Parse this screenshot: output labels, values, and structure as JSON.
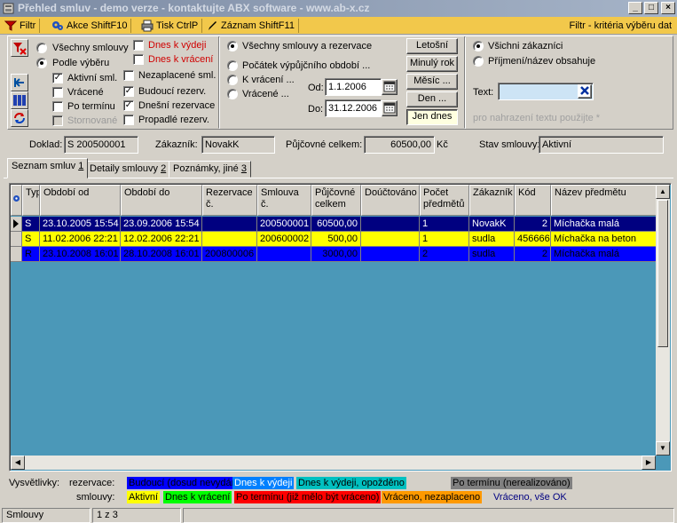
{
  "window": {
    "title": "Přehled smluv - demo verze - kontaktujte ABX software - www.ab-x.cz"
  },
  "toolbar": {
    "items": [
      {
        "label": "Filtr",
        "icon": "filter-icon"
      },
      {
        "label": "Akce ShiftF10",
        "icon": "gears-icon"
      },
      {
        "label": "Tisk CtrlP",
        "icon": "printer-icon"
      },
      {
        "label": "Záznam ShiftF11",
        "icon": "pencil-icon"
      }
    ],
    "right_text": "Filtr - kritéria výběru dat"
  },
  "filter": {
    "contracts": {
      "all": "Všechny smlouvy",
      "selected": "Podle výběru",
      "active": "Aktivní sml.",
      "returned": "Vrácené",
      "overdue": "Po termínu",
      "cancelled": "Stornované"
    },
    "due": {
      "due_issue": "Dnes k výdeji",
      "due_return": "Dnes k vrácení",
      "unpaid": "Nezaplacené sml.",
      "future_res": "Budoucí rezerv.",
      "today_res": "Dnešní rezervace",
      "expired_res": "Propadlé rezerv."
    },
    "period": {
      "all": "Všechny smlouvy a rezervace",
      "start": "Počátek výpůjčního období ...",
      "to_return": "K vrácení ...",
      "returned": "Vrácené ...",
      "from_label": "Od:",
      "from_value": "1.1.2006",
      "to_label": "Do:",
      "to_value": "31.12.2006"
    },
    "buttons": {
      "this_year": "Letošní",
      "last_year": "Minulý rok",
      "month": "Měsíc ...",
      "day": "Den ...",
      "today": "Jen dnes"
    },
    "customers": {
      "all": "Všichni zákazníci",
      "by_name": "Příjmení/název obsahuje",
      "text_label": "Text:",
      "text_value": "",
      "hint": "pro nahrazení textu použijte *"
    }
  },
  "info": {
    "doc_label": "Doklad:",
    "doc_value": "S 200500001",
    "cust_label": "Zákazník:",
    "cust_value": "NovakK",
    "total_label": "Půjčovné celkem:",
    "total_value": "60500,00",
    "currency": "Kč",
    "state_label": "Stav smlouvy:",
    "state_value": "Aktivní"
  },
  "tabs": [
    {
      "label": "Seznam smluv",
      "key": "1"
    },
    {
      "label": "Detaily smlouvy",
      "key": "2"
    },
    {
      "label": "Poznámky, jiné",
      "key": "3"
    }
  ],
  "grid": {
    "columns": [
      "Typ",
      "Období od",
      "Období do",
      "Rezervace č.",
      "Smlouva č.",
      "Půjčovné celkem",
      "Doúčtováno",
      "Počet předmětů",
      "Zákazník",
      "Kód",
      "Název předmětu"
    ],
    "rows": [
      [
        "S",
        "23.10.2005 15:54",
        "23.09.2006 15:54",
        "",
        "200500001",
        "60500,00",
        "",
        "1",
        "NovakK",
        "2",
        "Míchačka malá"
      ],
      [
        "S",
        "11.02.2006 22:21",
        "12.02.2006 22:21",
        "",
        "200600002",
        "500,00",
        "",
        "1",
        "sudla",
        "456666",
        "Míchačka na beton"
      ],
      [
        "R",
        "23.10.2008 16:01",
        "28.10.2008 16:01",
        "200800006",
        "",
        "3000,00",
        "",
        "2",
        "sudla",
        "2",
        "Míchačka malá"
      ]
    ],
    "row_colors": [
      "#000080",
      "#ffff00",
      "#0000ff"
    ],
    "row_text_colors": [
      "#ffffff",
      "#000000",
      "#000000"
    ]
  },
  "legend": {
    "title": "Vysvětlivky:",
    "res_label": "rezervace:",
    "contracts_label": "smlouvy:",
    "res_items": [
      {
        "text": "Budoucí (dosud nevydáno)",
        "bg": "#0000ff",
        "fg": "#000000"
      },
      {
        "text": "Dnes k výdeji",
        "bg": "#0080ff",
        "fg": "#ffffff"
      },
      {
        "text": "Dnes k výdeji, opožděno",
        "bg": "#00c0c0",
        "fg": "#000000"
      },
      {
        "text": "Po termínu (nerealizováno)",
        "bg": "#808080",
        "fg": "#000000"
      }
    ],
    "contract_items": [
      {
        "text": "Aktivní",
        "bg": "#ffff00",
        "fg": "#000000"
      },
      {
        "text": "Dnes k vrácení",
        "bg": "#00ff00",
        "fg": "#000000"
      },
      {
        "text": "Po termínu (již mělo být vráceno)",
        "bg": "#ff0000",
        "fg": "#000000"
      },
      {
        "text": "Vráceno, nezaplaceno",
        "bg": "#ff9900",
        "fg": "#000000"
      },
      {
        "text": "Vráceno, vše OK",
        "bg": "#d4d0c8",
        "fg": "#000080"
      }
    ]
  },
  "status": {
    "module": "Smlouvy",
    "position": "1 z 3"
  }
}
